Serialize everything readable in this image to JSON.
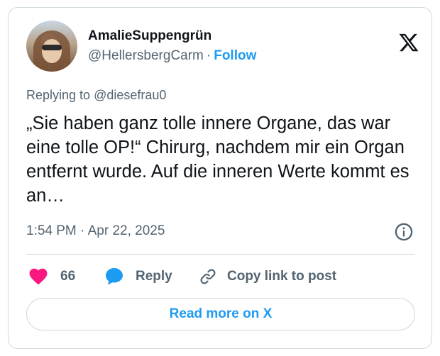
{
  "author": {
    "display_name": "AmalieSuppengrün",
    "handle": "@HellersbergCarm",
    "separator": "·",
    "follow_label": "Follow"
  },
  "reply_context": {
    "prefix": "Replying to",
    "mention": "@diesefrau0"
  },
  "tweet": {
    "text": "„Sie haben ganz tolle innere Organe, das war eine tolle OP!“ Chirurg, nachdem mir ein Organ entfernt wurde. Auf die inneren Werte kommt es an…",
    "timestamp": "1:54 PM · Apr 22, 2025"
  },
  "actions": {
    "like_count": "66",
    "reply_label": "Reply",
    "copy_link_label": "Copy link to post"
  },
  "read_more_label": "Read more on X",
  "icons": {
    "brand": "x-logo-icon",
    "info": "info-icon",
    "like": "heart-icon",
    "reply": "speech-bubble-icon",
    "copy": "link-icon"
  },
  "colors": {
    "accent": "#1d9bf0",
    "heart": "#f91880",
    "text_primary": "#0f1419",
    "text_secondary": "#536471",
    "border": "#cfd9de"
  }
}
